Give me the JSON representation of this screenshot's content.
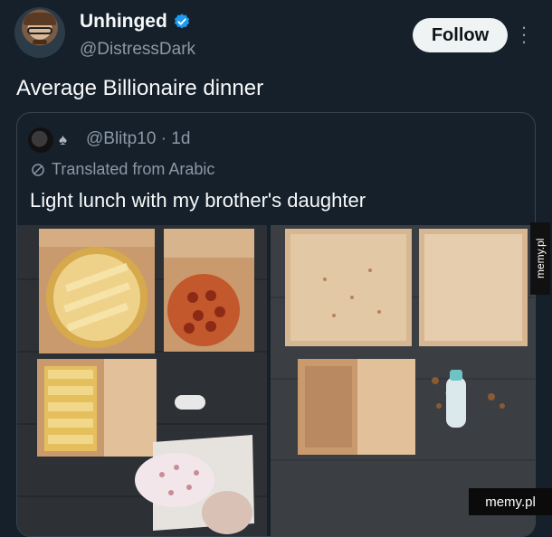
{
  "author": {
    "display_name": "Unhinged",
    "handle": "@DistressDark"
  },
  "follow_label": "Follow",
  "tweet_text": "Average Billionaire dinner",
  "quote": {
    "handle_time": "@Blitp10 · 1d",
    "translated_note": "Translated from Arabic",
    "text": "Light lunch with my brother's daughter"
  },
  "watermarks": {
    "side": "memy.pl",
    "bottom": "memy.pl"
  },
  "icons": {
    "verified": "verified-badge-icon",
    "more": "more-options-icon",
    "translate": "translate-globe-icon",
    "spade": "spade-icon"
  },
  "colors": {
    "background": "#15202b",
    "verified_blue": "#1d9bf0",
    "secondary_text": "#8b98a5",
    "follow_bg": "#eff3f4"
  }
}
